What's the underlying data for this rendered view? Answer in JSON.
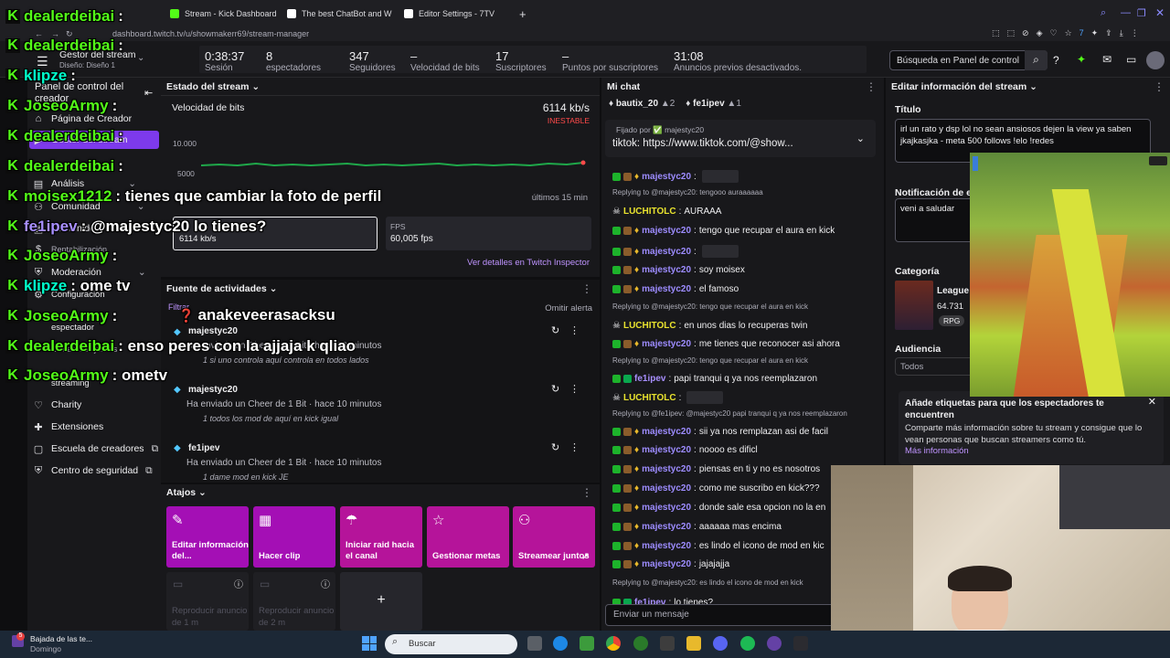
{
  "browser": {
    "tabs": [
      {
        "label": "Stream - Kick Dashboard",
        "color": "#53fc18"
      },
      {
        "label": "The best ChatBot and W",
        "color": "#ffffff"
      },
      {
        "label": "Editor Settings - 7TV",
        "color": "#ffffff"
      }
    ],
    "url": "dashboard.twitch.tv/u/showmakerr69/stream-manager"
  },
  "stats": [
    {
      "value": "0:38:37",
      "label": "Sesión"
    },
    {
      "value": "8",
      "label": "espectadores"
    },
    {
      "value": "347",
      "label": "Seguidores"
    },
    {
      "value": "–",
      "label": "Velocidad de bits"
    },
    {
      "value": "17",
      "label": "Suscriptores"
    },
    {
      "value": "–",
      "label": "Puntos por suscriptores"
    },
    {
      "value": "31:08",
      "label": "Anuncios previos desactivados."
    }
  ],
  "search": {
    "placeholder": "Búsqueda en Panel de control"
  },
  "sidebar": {
    "title": "Gestor del stream",
    "subtitle": "Diseño: Diseño 1",
    "panel_title": "Panel de control del creador",
    "items": [
      {
        "label": "Página de Creador",
        "icon": "home-icon"
      },
      {
        "label": "Gestor del stream",
        "icon": "video-icon"
      },
      {
        "label": "Análisis",
        "icon": "chart-icon"
      },
      {
        "label": "Comunidad",
        "icon": "people-icon"
      },
      {
        "label": "Contenido",
        "icon": "content-icon"
      },
      {
        "label": "Rentabilización",
        "icon": "money-icon"
      },
      {
        "label": "Moderación",
        "icon": "shield-icon"
      },
      {
        "label": "Configuración",
        "icon": "gear-icon"
      },
      {
        "label": "espectador",
        "icon": "eye-icon"
      },
      {
        "label": "Streamear juntos",
        "icon": "collab-icon"
      },
      {
        "label": "streaming",
        "icon": "stream-icon"
      },
      {
        "label": "Charity",
        "icon": "heart-icon"
      },
      {
        "label": "Extensiones",
        "icon": "extension-icon"
      },
      {
        "label": "Escuela de creadores",
        "icon": "school-icon"
      },
      {
        "label": "Centro de seguridad",
        "icon": "safety-icon"
      }
    ]
  },
  "stream_status": {
    "title": "Estado del stream",
    "bitrate_label": "Velocidad de bits",
    "bitrate_value": "6114 kb/s",
    "unstable": "INESTABLE",
    "y_high": "10.000",
    "y_low": "5000",
    "range": "últimos 15 min",
    "box1_label": "",
    "box1_value": "6114 kb/s",
    "fps_label": "FPS",
    "fps_value": "60,005 fps",
    "inspector_link": "Ver detalles en Twitch Inspector"
  },
  "activity": {
    "title": "Fuente de actividades",
    "filter": "Filtrar",
    "skip": "Omitir alerta",
    "items": [
      {
        "user": "majestyc20",
        "detail": "Ha enviado un Cheer de 1 Bit · hace 10 minutos",
        "msg": "1 si uno controla aquí controla en todos lados"
      },
      {
        "user": "majestyc20",
        "detail": "Ha enviado un Cheer de 1 Bit · hace 10 minutos",
        "msg": "1 todos los mod de aquí en kick igual"
      },
      {
        "user": "fe1ipev",
        "detail": "Ha enviado un Cheer de 1 Bit · hace 10 minutos",
        "msg": "1 dame mod en kick JE"
      }
    ]
  },
  "shortcuts": {
    "title": "Atajos",
    "items": [
      {
        "label": "Editar información del...",
        "icon": "✎",
        "color": "#a40fb5"
      },
      {
        "label": "Hacer clip",
        "icon": "▦",
        "color": "#a40fb5"
      },
      {
        "label": "Iniciar raid hacia el canal",
        "icon": "☂",
        "color": "#b5149a"
      },
      {
        "label": "Gestionar metas",
        "icon": "☆",
        "color": "#b5149a"
      },
      {
        "label": "Streamear juntos",
        "icon": "⚇",
        "color": "#b5149a"
      }
    ],
    "ads": [
      "Reproducir anuncio de 1 m",
      "Reproducir anuncio de 2 m"
    ],
    "add": "+"
  },
  "chat": {
    "title": "Mi chat",
    "top_users": [
      {
        "name": "bautix_20",
        "count": "2"
      },
      {
        "name": "fe1ipev",
        "count": "1"
      }
    ],
    "pinned_by": "Fijado por ✅ majestyc20",
    "pinned_msg": "tiktok: https://www.tiktok.com/@show...",
    "lines": [
      {
        "type": "msg",
        "user": "majestyc20",
        "text": "",
        "emote": true
      },
      {
        "type": "reply",
        "text": "Replying to @majestyc20: tengooo auraaaaaa"
      },
      {
        "type": "msg",
        "user": "LUCHITOLC",
        "text": "AURAAA",
        "alt": true
      },
      {
        "type": "msg",
        "user": "majestyc20",
        "text": "tengo que recupar el aura en kick"
      },
      {
        "type": "msg",
        "user": "majestyc20",
        "text": "",
        "emote": true
      },
      {
        "type": "msg",
        "user": "majestyc20",
        "text": "soy moisex"
      },
      {
        "type": "msg",
        "user": "majestyc20",
        "text": "el famoso"
      },
      {
        "type": "reply",
        "text": "Replying to @majestyc20: tengo que recupar el aura en kick"
      },
      {
        "type": "msg",
        "user": "LUCHITOLC",
        "text": "en unos dias lo recuperas twin",
        "alt": true
      },
      {
        "type": "msg",
        "user": "majestyc20",
        "text": "me tienes que reconocer asi ahora"
      },
      {
        "type": "reply",
        "text": "Replying to @majestyc20: tengo que recupar el aura en kick"
      },
      {
        "type": "msg",
        "user": "fe1ipev",
        "text": "papi tranqui q ya nos reemplazaron",
        "sub": true
      },
      {
        "type": "msg",
        "user": "LUCHITOLC",
        "text": "",
        "alt": true,
        "emote": true
      },
      {
        "type": "reply",
        "text": "Replying to @fe1ipev: @majestyc20 papi tranqui q ya nos reemplazaron"
      },
      {
        "type": "msg",
        "user": "majestyc20",
        "text": "sii ya nos remplazan asi de facil"
      },
      {
        "type": "msg",
        "user": "majestyc20",
        "text": "noooo es dificl"
      },
      {
        "type": "msg",
        "user": "majestyc20",
        "text": "piensas en ti y no es nosotros"
      },
      {
        "type": "msg",
        "user": "majestyc20",
        "text": "como me suscribo en kick???"
      },
      {
        "type": "msg",
        "user": "majestyc20",
        "text": "donde sale esa opcion no la en"
      },
      {
        "type": "msg",
        "user": "majestyc20",
        "text": "aaaaaa mas encima"
      },
      {
        "type": "msg",
        "user": "majestyc20",
        "text": "es lindo el icono de mod en kic"
      },
      {
        "type": "msg",
        "user": "majestyc20",
        "text": "jajajajja"
      },
      {
        "type": "reply",
        "text": "Replying to @majestyc20: es lindo el icono de mod en kick"
      },
      {
        "type": "msg",
        "user": "fe1ipev",
        "text": "lo tienes?",
        "sub": true
      }
    ],
    "input_placeholder": "Enviar un mensaje"
  },
  "edit_info": {
    "title": "Editar información del stream",
    "title_label": "Título",
    "title_value": "irl un rato y dsp lol  no sean ansiosos dejen la view ya saben jkajkasjka - meta 500 follows !elo !redes",
    "notif_label": "Notificación de en",
    "notif_value": "veni a saludar",
    "category_label": "Categoría",
    "category_name": "League",
    "category_viewers": "64.731",
    "category_tag": "RPG",
    "audience_label": "Audiencia",
    "audience_value": "Todos",
    "tip_title": "Añade etiquetas para que los espectadores te encuentren",
    "tip_body": "Comparte más información sobre tu stream y consigue que lo vean personas que buscan streamers como tú.",
    "tip_link": "Más información"
  },
  "overlay_chat": [
    {
      "user": "dealerdeibai",
      "text": ":",
      "color": "#53fc18"
    },
    {
      "user": "dealerdeibai",
      "text": ":",
      "color": "#53fc18"
    },
    {
      "user": "klipze",
      "text": ":",
      "color": "#00ffcc"
    },
    {
      "user": "JoseoArmy",
      "text": ":",
      "color": "#53fc18"
    },
    {
      "user": "dealerdeibai",
      "text": ":",
      "color": "#53fc18"
    },
    {
      "user": "dealerdeibai",
      "text": ":",
      "color": "#53fc18"
    },
    {
      "user": "moisex1212",
      "text": ": tienes que cambiar la foto de perfil",
      "color": "#53fc18"
    },
    {
      "user": "fe1ipev",
      "text": ": @majestyc20 lo tienes?",
      "color": "#a88fff"
    },
    {
      "user": "JoseoArmy",
      "text": ":",
      "color": "#53fc18"
    },
    {
      "user": "klipze",
      "text": ": ome tv",
      "color": "#00ffcc"
    },
    {
      "user": "JoseoArmy",
      "text": ":",
      "color": "#53fc18"
    },
    {
      "user": "dealerdeibai",
      "text": ": enso peres con la ajjaja k qliao",
      "color": "#53fc18"
    },
    {
      "user": "JoseoArmy",
      "text": ": ometv",
      "color": "#53fc18"
    }
  ],
  "overlay_extra": "anakeveerasacksu",
  "taskbar": {
    "notif_title": "Bajada de las te...",
    "notif_sub": "Domingo",
    "search": "Buscar"
  }
}
